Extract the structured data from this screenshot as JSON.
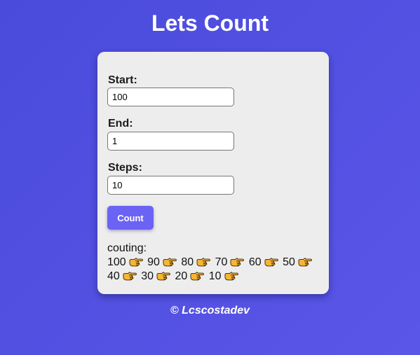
{
  "header": {
    "title": "Lets Count"
  },
  "form": {
    "start_label": "Start:",
    "start_value": "100",
    "end_label": "End:",
    "end_value": "1",
    "steps_label": "Steps:",
    "steps_value": "10",
    "count_button_label": "Count"
  },
  "result": {
    "label": "couting:",
    "values": [
      "100",
      "90",
      "80",
      "70",
      "60",
      "50",
      "40",
      "30",
      "20",
      "10"
    ],
    "separator_icon": "pointing-hand-icon"
  },
  "footer": {
    "text": "© Lcscostadev"
  },
  "colors": {
    "background": "#5150e2",
    "card": "#ededed",
    "button": "#6b63f4",
    "hand": "#f6b535"
  }
}
